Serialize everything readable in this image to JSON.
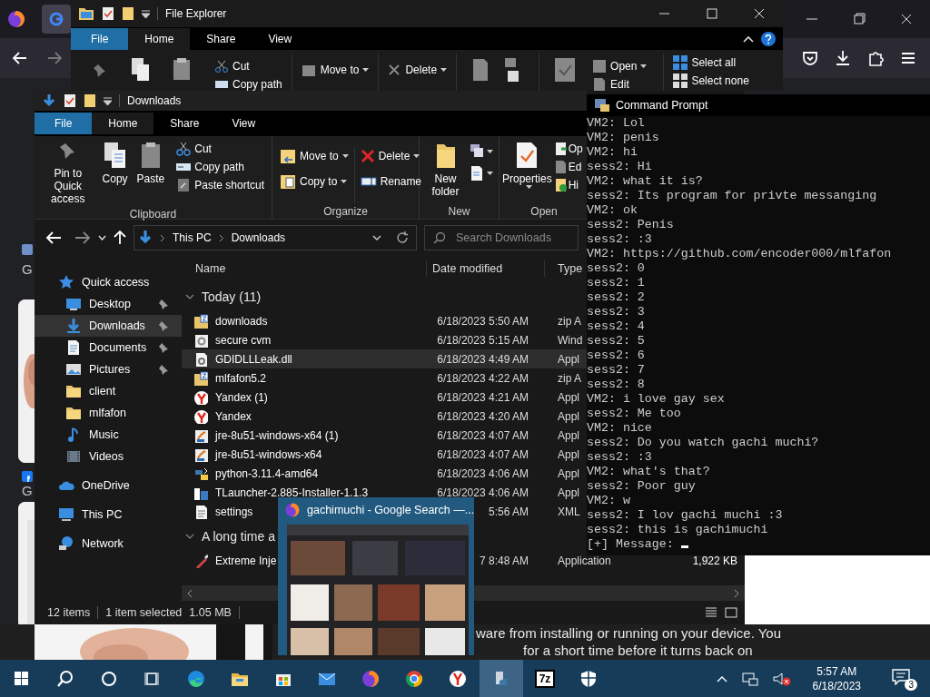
{
  "browser": {
    "page_labels": [
      "G",
      "G"
    ],
    "notice_lines": [
      "ware from installing or running on your device. You",
      "for a short time before it turns back on"
    ]
  },
  "back_explorer": {
    "title": "File Explorer",
    "tabs": [
      {
        "label": "File",
        "kind": "file",
        "selected": false
      },
      {
        "label": "Home",
        "kind": "tab",
        "selected": true
      },
      {
        "label": "Share",
        "kind": "tab",
        "selected": false
      },
      {
        "label": "View",
        "kind": "tab",
        "selected": false
      }
    ],
    "commands": [
      {
        "label": "Cut",
        "dropdown": false
      },
      {
        "label": "Copy path",
        "dropdown": false
      },
      {
        "label": "Move to",
        "dropdown": true
      },
      {
        "label": "Delete",
        "dropdown": true
      },
      {
        "label": "Open",
        "dropdown": true
      },
      {
        "label": "Edit",
        "dropdown": false
      },
      {
        "label": "Select all",
        "dropdown": false
      },
      {
        "label": "Select none",
        "dropdown": false
      }
    ]
  },
  "explorer": {
    "title": "Downloads",
    "tabs": [
      {
        "label": "File",
        "kind": "file",
        "selected": false
      },
      {
        "label": "Home",
        "kind": "tab",
        "selected": true
      },
      {
        "label": "Share",
        "kind": "tab",
        "selected": false
      },
      {
        "label": "View",
        "kind": "tab",
        "selected": false
      }
    ],
    "ribbon": {
      "clipboard": {
        "label": "Clipboard",
        "large": [
          "Pin to Quick access",
          "Copy",
          "Paste"
        ],
        "small": [
          "Cut",
          "Copy path",
          "Paste shortcut"
        ]
      },
      "organize": {
        "label": "Organize",
        "commands": [
          {
            "label": "Move to",
            "dropdown": true
          },
          {
            "label": "Copy to",
            "dropdown": true
          },
          {
            "label": "Delete",
            "dropdown": true
          },
          {
            "label": "Rename",
            "dropdown": false
          }
        ]
      },
      "new": {
        "label": "New",
        "large": "New folder"
      },
      "open": {
        "label": "Open",
        "large": "Properties",
        "small": [
          "Op",
          "Ed",
          "Hi"
        ]
      }
    },
    "path": [
      "This PC",
      "Downloads"
    ],
    "search": {
      "placeholder": "Search Downloads"
    },
    "nav": [
      {
        "label": "Quick access",
        "kind": "star",
        "selected": false,
        "children": [
          {
            "label": "Desktop",
            "kind": "desktop",
            "pinned": true,
            "selected": false
          },
          {
            "label": "Downloads",
            "kind": "download",
            "pinned": true,
            "selected": true
          },
          {
            "label": "Documents",
            "kind": "document",
            "pinned": true,
            "selected": false
          },
          {
            "label": "Pictures",
            "kind": "pictures",
            "pinned": true,
            "selected": false
          },
          {
            "label": "client",
            "kind": "folder",
            "pinned": false,
            "selected": false
          },
          {
            "label": "mlfafon",
            "kind": "folder",
            "pinned": false,
            "selected": false
          },
          {
            "label": "Music",
            "kind": "music",
            "pinned": false,
            "selected": false
          },
          {
            "label": "Videos",
            "kind": "videos",
            "pinned": false,
            "selected": false
          }
        ]
      },
      {
        "label": "OneDrive",
        "kind": "cloud",
        "selected": false
      },
      {
        "label": "This PC",
        "kind": "pc",
        "selected": false
      },
      {
        "label": "Network",
        "kind": "network",
        "selected": false
      }
    ],
    "columns": [
      "Name",
      "Date modified",
      "Type"
    ],
    "groups": [
      {
        "label": "Today (11)",
        "expanded": true,
        "files": [
          {
            "name": "downloads",
            "date": "6/18/2023 5:50 AM",
            "type": "zip A",
            "kind": "zip",
            "selected": false
          },
          {
            "name": "secure cvm",
            "date": "6/18/2023 5:15 AM",
            "type": "Wind",
            "kind": "config",
            "selected": false
          },
          {
            "name": "GDIDLLLeak.dll",
            "date": "6/18/2023 4:49 AM",
            "type": "Appl",
            "kind": "dll",
            "selected": true
          },
          {
            "name": "mlfafon5.2",
            "date": "6/18/2023 4:22 AM",
            "type": "zip A",
            "kind": "zip",
            "selected": false
          },
          {
            "name": "Yandex (1)",
            "date": "6/18/2023 4:21 AM",
            "type": "Appl",
            "kind": "yandex",
            "selected": false
          },
          {
            "name": "Yandex",
            "date": "6/18/2023 4:20 AM",
            "type": "Appl",
            "kind": "yandex",
            "selected": false
          },
          {
            "name": "jre-8u51-windows-x64 (1)",
            "date": "6/18/2023 4:07 AM",
            "type": "Appl",
            "kind": "installer",
            "selected": false
          },
          {
            "name": "jre-8u51-windows-x64",
            "date": "6/18/2023 4:07 AM",
            "type": "Appl",
            "kind": "installer",
            "selected": false
          },
          {
            "name": "python-3.11.4-amd64",
            "date": "6/18/2023 4:06 AM",
            "type": "Appl",
            "kind": "python",
            "selected": false
          },
          {
            "name": "TLauncher-2.885-Installer-1.1.3",
            "date": "6/18/2023 4:06 AM",
            "type": "Appl",
            "kind": "launcher",
            "selected": false
          },
          {
            "name": "settings",
            "date": "5:56 AM",
            "type": "XML",
            "kind": "xml",
            "selected": false
          }
        ]
      },
      {
        "label": "A long time a",
        "expanded": true,
        "files": [
          {
            "name": "Extreme Inje",
            "date": "7 8:48 AM",
            "type": "Application",
            "size": "1,922 KB",
            "kind": "tool",
            "selected": false
          }
        ]
      }
    ],
    "status": {
      "count": "12 items",
      "selection": "1 item selected",
      "size": "1.05 MB"
    }
  },
  "console": {
    "title": "Command Prompt",
    "lines": [
      "VM2: Lol",
      "VM2: penis",
      "VM2: hi",
      "sess2: Hi",
      "VM2: what it is?",
      "sess2: Its program for privte messanging",
      "VM2: ok",
      "sess2: Penis",
      "sess2: :3",
      "VM2: https://github.com/encoder000/mlfafon",
      "sess2: 0",
      "sess2: 1",
      "sess2: 2",
      "sess2: 3",
      "sess2: 4",
      "sess2: 5",
      "sess2: 6",
      "sess2: 7",
      "sess2: 8",
      "VM2: i love gay sex",
      "sess2: Me too",
      "VM2: nice",
      "sess2: Do you watch gachi muchi?",
      "sess2: :3",
      "VM2: what's that?",
      "sess2: Poor guy",
      "VM2: w",
      "sess2: I lov gachi muchi :3",
      "sess2: this is gachimuchi"
    ],
    "prompt": "[+] Message:"
  },
  "preview": {
    "title": "gachimuchi - Google Search —..."
  },
  "taskbar": {
    "apps": [
      {
        "kind": "start",
        "active": false
      },
      {
        "kind": "search",
        "active": false
      },
      {
        "kind": "cortana",
        "active": false
      },
      {
        "kind": "taskview",
        "active": false
      },
      {
        "kind": "edge",
        "active": false
      },
      {
        "kind": "explorer",
        "active": false
      },
      {
        "kind": "store",
        "active": false
      },
      {
        "kind": "mail",
        "active": false
      },
      {
        "kind": "firefox",
        "active": false
      },
      {
        "kind": "chrome",
        "active": false
      },
      {
        "kind": "yandex",
        "active": false
      },
      {
        "kind": "pyapp",
        "active": true
      },
      {
        "kind": "sevenzip",
        "glyph": "7z",
        "active": false
      },
      {
        "kind": "shield",
        "active": false
      }
    ],
    "volume": {
      "muted": true
    },
    "clock": {
      "time": "5:57 AM",
      "date": "6/18/2023"
    },
    "notifications": {
      "count": "3"
    }
  }
}
